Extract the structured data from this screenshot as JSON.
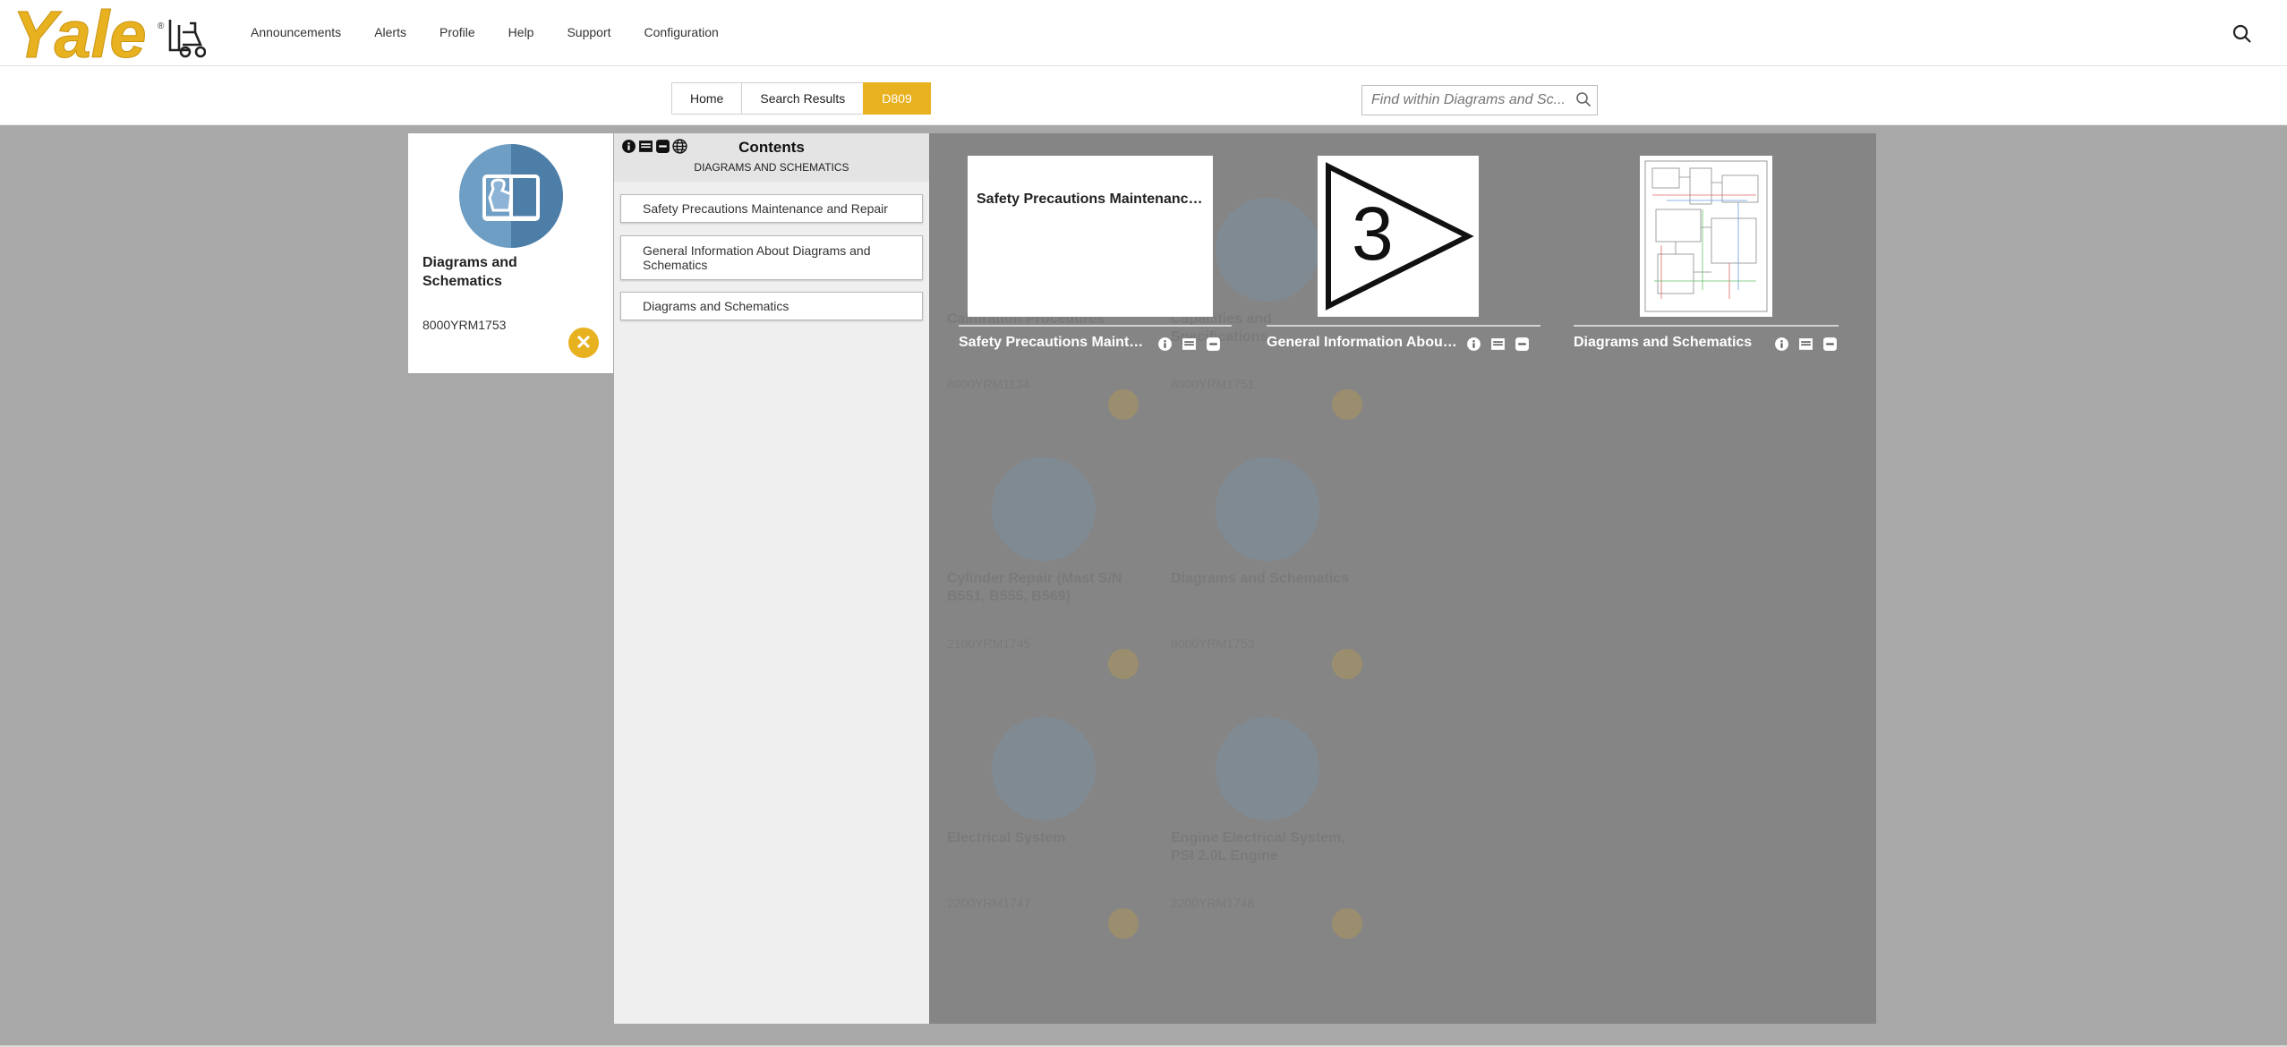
{
  "brand": {
    "name": "Yale",
    "accent": "#e8b120"
  },
  "nav": {
    "items": [
      "Announcements",
      "Alerts",
      "Profile",
      "Help",
      "Support",
      "Configuration"
    ]
  },
  "breadcrumb": {
    "home": "Home",
    "search_results": "Search Results",
    "current": "D809"
  },
  "find": {
    "placeholder": "Find within Diagrams and Sc..."
  },
  "card": {
    "title": "Diagrams and Schematics",
    "code": "8000YRM1753",
    "close": "✕"
  },
  "contents": {
    "title": "Contents",
    "subtitle": "DIAGRAMS AND SCHEMATICS",
    "items": [
      "Safety Precautions Maintenance and Repair",
      "General Information About Diagrams and Schematics",
      "Diagrams and Schematics"
    ]
  },
  "results": [
    {
      "thumb_text": "Safety Precautions Maintenance...",
      "label": "Safety Precautions Mainte..."
    },
    {
      "thumb_text": "3",
      "label": "General Information About ..."
    },
    {
      "thumb_text": "",
      "label": "Diagrams and Schematics"
    }
  ],
  "background_grid": [
    {
      "title": "Calibration Procedures",
      "code": "8000YRM1134"
    },
    {
      "title": "Capacities and Specifications",
      "code": "8000YRM1751"
    },
    {
      "title": "Cylinder Repair (Mast S/N B551, B555, B569)",
      "code": "2100YRM1745"
    },
    {
      "title": "Diagrams and Schematics",
      "code": "8000YRM1753"
    },
    {
      "title": "Electrical System",
      "code": "2200YRM1747"
    },
    {
      "title": "Engine Electrical System, PSI 2.0L Engine",
      "code": "2200YRM1748"
    }
  ]
}
